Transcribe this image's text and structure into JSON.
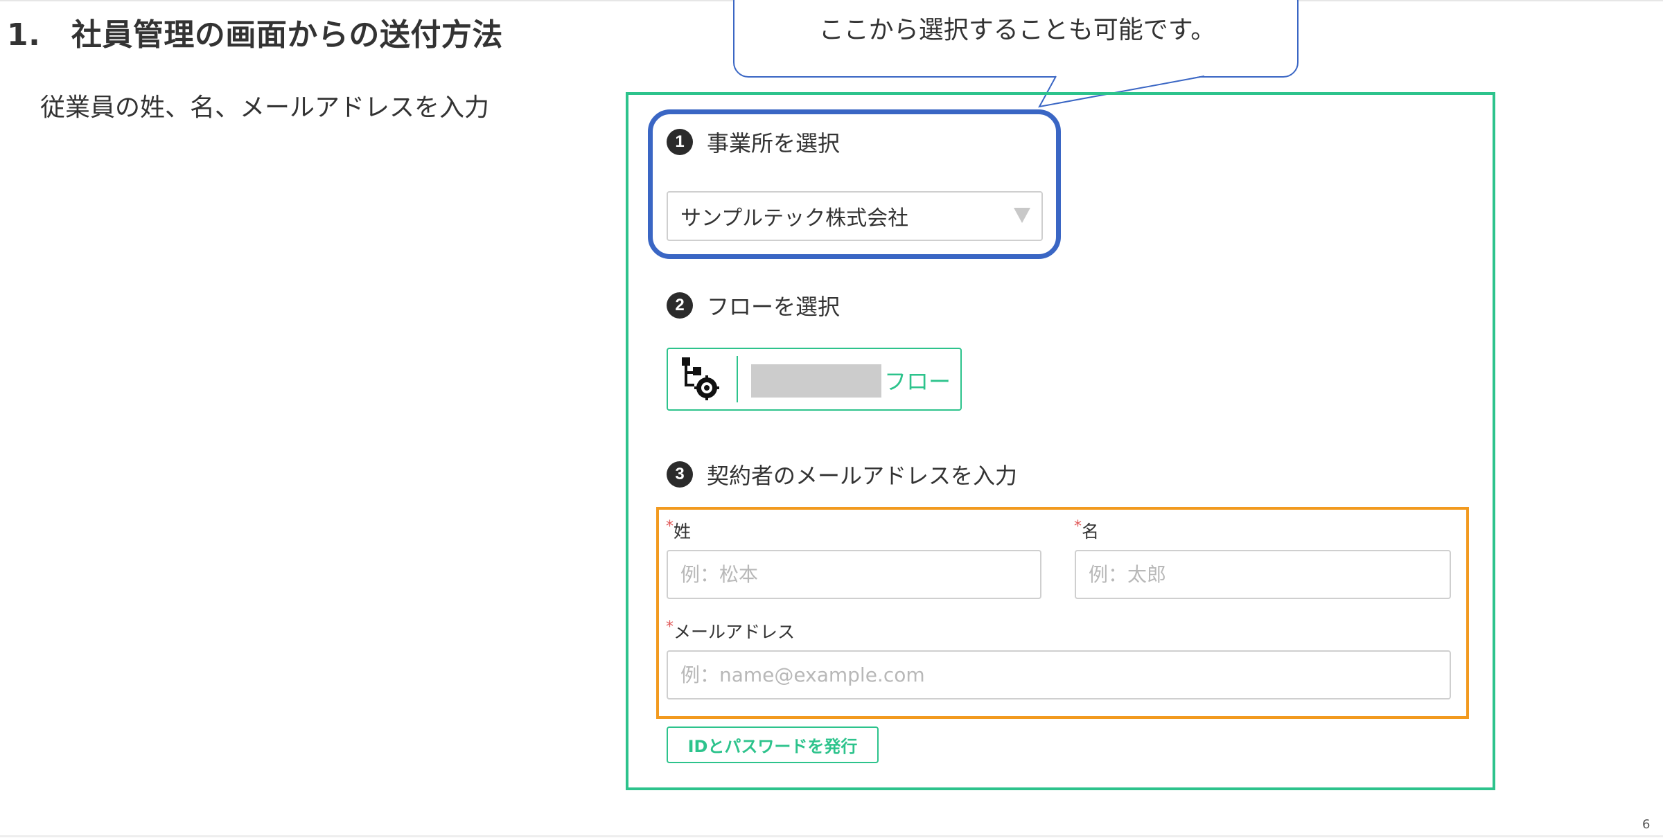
{
  "slide": {
    "title": "1.　社員管理の画面からの送付方法",
    "subtitle": "従業員の姓、名、メールアドレスを入力",
    "page_number": "6"
  },
  "callout": {
    "text": "ここから選択することも可能です。"
  },
  "form": {
    "step1": {
      "number": "1",
      "label": "事業所を選択",
      "selected_value": "サンプルテック株式会社"
    },
    "step2": {
      "number": "2",
      "label": "フローを選択",
      "flow_button_label": "フロー",
      "flow_icon": "flow-settings-icon"
    },
    "step3": {
      "number": "3",
      "label": "契約者のメールアドレスを入力",
      "required_mark": "*",
      "last_name_label": "姓",
      "last_name_placeholder": "例：松本",
      "first_name_label": "名",
      "first_name_placeholder": "例：太郎",
      "email_label": "メールアドレス",
      "email_placeholder": "例：name@example.com"
    },
    "issue_button_label": "IDとパスワードを発行"
  },
  "colors": {
    "green_frame": "#2dc38c",
    "blue_highlight": "#3a66c4",
    "orange_highlight": "#f29a1f",
    "required_mark": "#e05a5a"
  }
}
